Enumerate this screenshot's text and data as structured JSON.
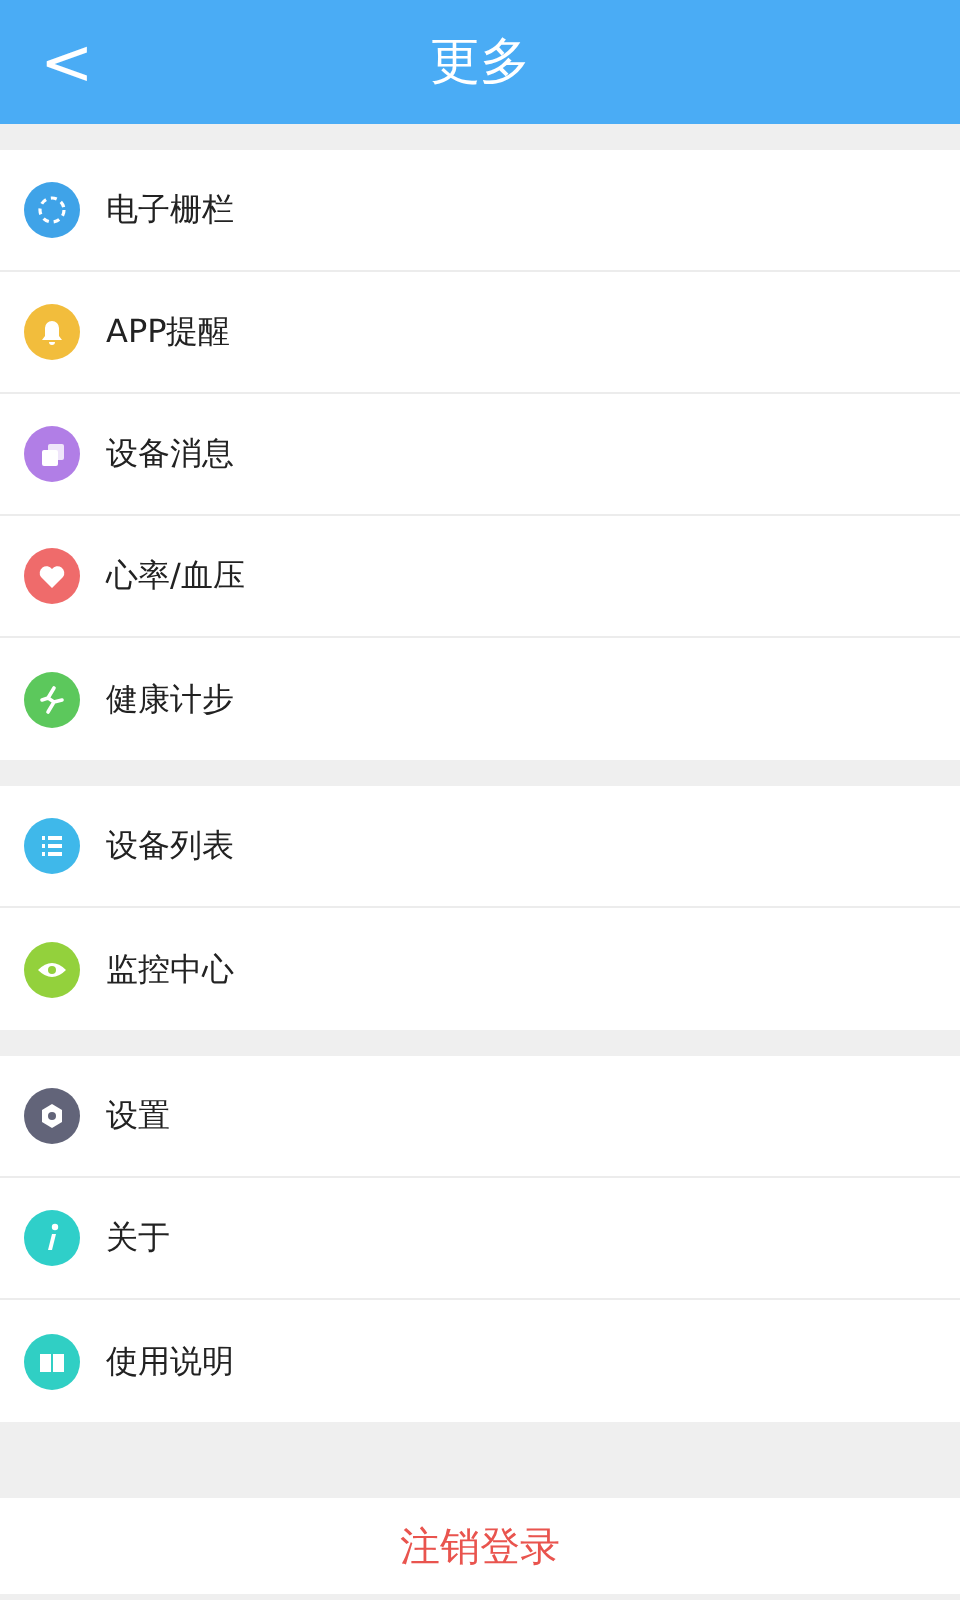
{
  "header": {
    "back": "<",
    "title": "更多"
  },
  "groups": [
    {
      "items": [
        {
          "label": "电子栅栏",
          "kind": "fence",
          "color": "#3fa3e8"
        },
        {
          "label": "APP提醒",
          "kind": "bell",
          "color": "#f2bd3c"
        },
        {
          "label": "设备消息",
          "kind": "messages",
          "color": "#b17ee6"
        },
        {
          "label": "心率/血压",
          "kind": "heart",
          "color": "#ef6b6b"
        },
        {
          "label": "健康计步",
          "kind": "runner",
          "color": "#5cc85c"
        }
      ]
    },
    {
      "items": [
        {
          "label": "设备列表",
          "kind": "list",
          "color": "#3fb8ea"
        },
        {
          "label": "监控中心",
          "kind": "eye",
          "color": "#93d13c"
        }
      ]
    },
    {
      "items": [
        {
          "label": "设置",
          "kind": "gear",
          "color": "#626479"
        },
        {
          "label": "关于",
          "kind": "info",
          "color": "#2fcfc9"
        },
        {
          "label": "使用说明",
          "kind": "book",
          "color": "#30cfc4"
        }
      ]
    }
  ],
  "logout": "注销登录"
}
